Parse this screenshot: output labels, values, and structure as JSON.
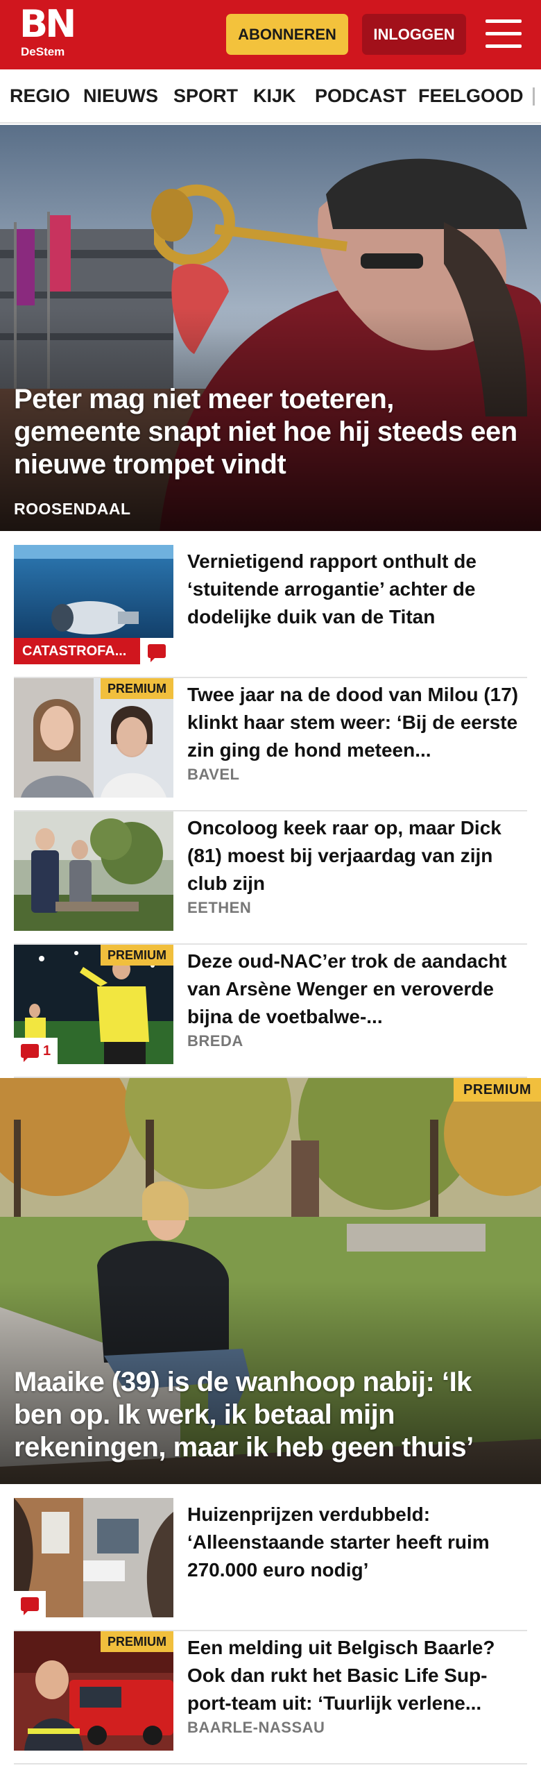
{
  "header": {
    "logo_main": "BN",
    "logo_sub": "DeStem",
    "subscribe_label": "ABONNEREN",
    "login_label": "INLOGGEN",
    "menu_icon": "hamburger-menu-icon",
    "brand_color": "#d0161e"
  },
  "nav": {
    "items": [
      "REGIO",
      "NIEUWS",
      "SPORT",
      "KIJK",
      "PODCAST",
      "FEELGOOD"
    ]
  },
  "hero1": {
    "title": "Peter mag niet meer toeteren, gemeente snapt niet hoe hij steeds een nieuwe trompet vindt",
    "location": "ROOSENDAAL"
  },
  "articles1": [
    {
      "title": "Vernietigend rapport onthult de ‘stuitende arrogantie’ achter de dodelijke duik van de Titan",
      "category": "CATASTROFA...",
      "comment_icon": "comment-icon",
      "premium": false,
      "location": ""
    },
    {
      "title": "Twee jaar na de dood van Milou (17) klinkt haar stem weer: ‘Bij de eerste zin ging de hond meteen...",
      "premium_label": "PREMIUM",
      "location": "BAVEL"
    },
    {
      "title": "Oncoloog keek raar op, maar Dick (81) moest bij verjaardag van zijn club zijn",
      "location": "EETHEN"
    },
    {
      "title": "Deze oud-NAC’er trok de aandacht van Arsène Wenger en veroverde bijna de voetbalwe-...",
      "premium_label": "PREMIUM",
      "comment_count": "1",
      "location": "BREDA"
    }
  ],
  "hero2": {
    "premium_label": "PREMIUM",
    "title": "Maaike (39) is de wanhoop nabij: ‘Ik ben op. Ik werk, ik betaal mijn rekeningen, maar ik heb geen thuis’"
  },
  "articles2": [
    {
      "title": "Huizenprijzen verdubbeld: ‘Alleenstaande starter heeft ruim 270.000 euro nodig’",
      "comment_icon": "comment-icon"
    },
    {
      "title": "Een melding uit Belgisch Baarle? Ook dan rukt het Basic Life Sup-port-team uit: ‘Tuurlijk verlene...",
      "premium_label": "PREMIUM",
      "location": "BAARLE-NASSAU"
    }
  ]
}
